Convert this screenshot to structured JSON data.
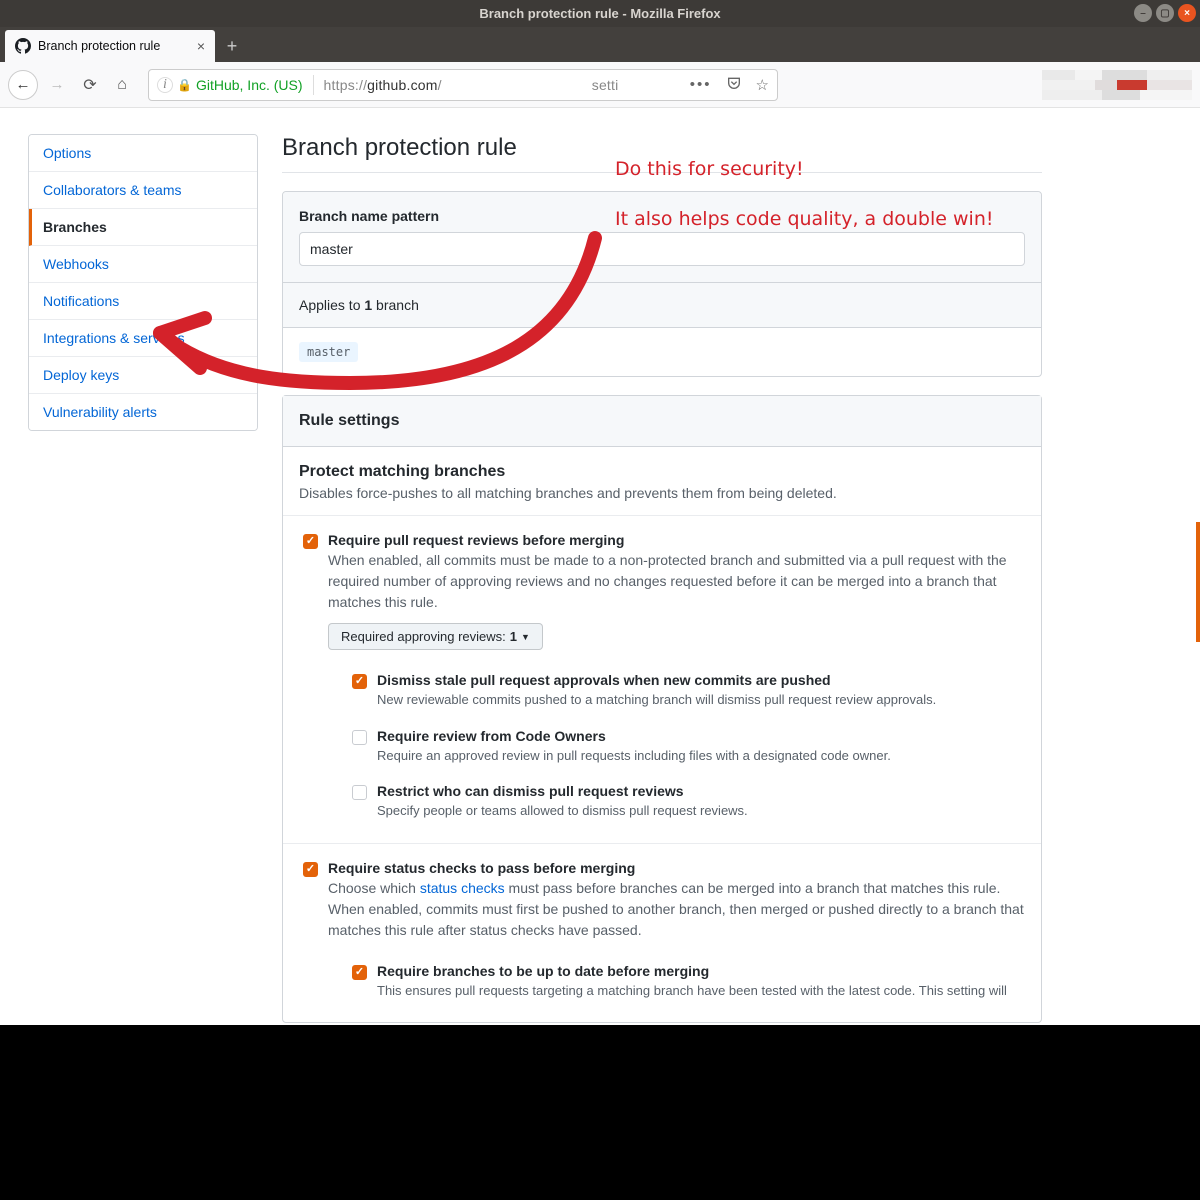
{
  "window": {
    "title": "Branch protection rule - Mozilla Firefox"
  },
  "tab": {
    "title": "Branch protection rule"
  },
  "urlbar": {
    "identity": "GitHub, Inc. (US)",
    "scheme": "https://",
    "host": "github.com",
    "path_hint": "setti"
  },
  "annotations": {
    "line1": "Do this for security!",
    "line2": "It also helps code quality, a double win!"
  },
  "sidenav": {
    "items": [
      {
        "label": "Options"
      },
      {
        "label": "Collaborators & teams"
      },
      {
        "label": "Branches",
        "active": true
      },
      {
        "label": "Webhooks"
      },
      {
        "label": "Notifications"
      },
      {
        "label": "Integrations & services"
      },
      {
        "label": "Deploy keys"
      },
      {
        "label": "Vulnerability alerts"
      }
    ]
  },
  "page_title": "Branch protection rule",
  "pattern": {
    "label": "Branch name pattern",
    "value": "master",
    "applies_pre": "Applies to ",
    "applies_count": "1",
    "applies_post": " branch",
    "chip": "master"
  },
  "rule_settings": {
    "heading": "Rule settings",
    "protect": {
      "title": "Protect matching branches",
      "desc": "Disables force-pushes to all matching branches and prevents them from being deleted."
    },
    "rules": [
      {
        "checked": true,
        "title": "Require pull request reviews before merging",
        "desc": "When enabled, all commits must be made to a non-protected branch and submitted via a pull request with the required number of approving reviews and no changes requested before it can be merged into a branch that matches this rule.",
        "dropdown_label": "Required approving reviews: ",
        "dropdown_value": "1",
        "subrules": [
          {
            "checked": true,
            "title": "Dismiss stale pull request approvals when new commits are pushed",
            "desc": "New reviewable commits pushed to a matching branch will dismiss pull request review approvals."
          },
          {
            "checked": false,
            "title": "Require review from Code Owners",
            "desc": "Require an approved review in pull requests including files with a designated code owner."
          },
          {
            "checked": false,
            "title": "Restrict who can dismiss pull request reviews",
            "desc": "Specify people or teams allowed to dismiss pull request reviews."
          }
        ]
      },
      {
        "checked": true,
        "title": "Require status checks to pass before merging",
        "desc_pre": "Choose which ",
        "desc_link": "status checks",
        "desc_post": " must pass before branches can be merged into a branch that matches this rule. When enabled, commits must first be pushed to another branch, then merged or pushed directly to a branch that matches this rule after status checks have passed.",
        "subrules": [
          {
            "checked": true,
            "title": "Require branches to be up to date before merging",
            "desc": "This ensures pull requests targeting a matching branch have been tested with the latest code. This setting will"
          }
        ]
      }
    ]
  }
}
